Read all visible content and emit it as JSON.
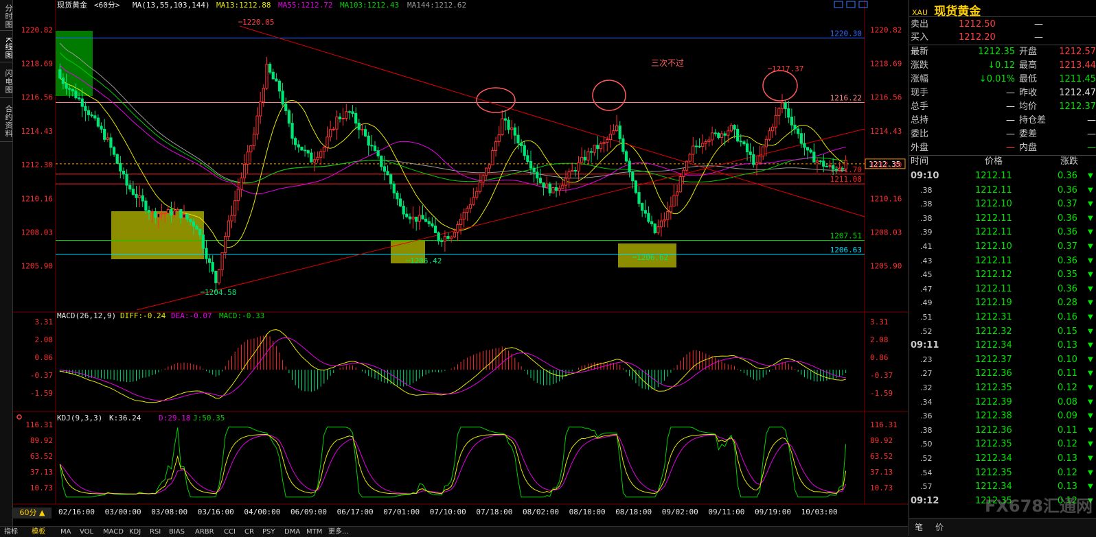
{
  "side_tabs": [
    "分时图",
    "K线图",
    "闪电图",
    "合约资料"
  ],
  "header": {
    "symbol": "现货黄金",
    "period_tag": "<60分>",
    "ma_params": "MA(13,55,103,144)",
    "ma13": "MA13:1212.88",
    "ma55": "MA55:1212.72",
    "ma103": "MA103:1212.43",
    "ma144": "MA144:1212.62"
  },
  "colors": {
    "up": "#ff3030",
    "down": "#00e676",
    "ma13": "#e8e800",
    "ma55": "#e600e6",
    "ma103": "#00d000",
    "ma144": "#9a9a9a",
    "trend": "#e00000",
    "zone": "#a6a600",
    "zone_green": "#008800",
    "support_cyan": "#00e0ff"
  },
  "price_axis": [
    "1220.82",
    "1218.69",
    "1216.56",
    "1214.43",
    "1212.30",
    "1210.16",
    "1208.03",
    "1205.90"
  ],
  "price_range": [
    1203.2,
    1221.4
  ],
  "hlines": [
    {
      "price": 1220.3,
      "label": "1220.30",
      "color": "#2f6cff"
    },
    {
      "price": 1216.22,
      "label": "1216.22",
      "color": "#ff8080"
    },
    {
      "price": 1212.35,
      "label": "",
      "color": "#ff9900",
      "dash": true
    },
    {
      "price": 1211.7,
      "label": "1211.70",
      "color": "#ff2020"
    },
    {
      "price": 1211.08,
      "label": "1211.08",
      "color": "#ff2020"
    },
    {
      "price": 1207.51,
      "label": "1207.51",
      "color": "#00d000"
    },
    {
      "price": 1206.63,
      "label": "1206.63",
      "color": "#00e0ff"
    }
  ],
  "last_price_tag": "1212.35",
  "marks": [
    {
      "label": "1220.05"
    },
    {
      "label": "1204.58"
    },
    {
      "label": "1206.42"
    },
    {
      "label": "1206.62"
    },
    {
      "label": "1217.37"
    }
  ],
  "annotation": "三次不过",
  "x_labels": [
    "02/16:00",
    "03/00:00",
    "03/08:00",
    "03/16:00",
    "04/00:00",
    "06/09:00",
    "06/17:00",
    "07/01:00",
    "07/10:00",
    "07/18:00",
    "08/02:00",
    "08/10:00",
    "08/18:00",
    "09/02:00",
    "09/11:00",
    "09/19:00",
    "10/03:00"
  ],
  "macd": {
    "title": "MACD(26,12,9)",
    "diff": "DIFF:-0.24",
    "dea": "DEA:-0.07",
    "macd": "MACD:-0.33",
    "axis": [
      "3.31",
      "2.08",
      "0.86",
      "-0.37",
      "-1.59"
    ]
  },
  "kdj": {
    "title": "KDJ(9,3,3)",
    "k": "K:36.24",
    "d": "D:29.18",
    "j": "J:50.35",
    "axis": [
      "116.31",
      "89.92",
      "63.52",
      "37.13",
      "10.73"
    ]
  },
  "period_button": "60分 ▲",
  "indicator_tabs": [
    "指标",
    "模板",
    "MA",
    "VOL",
    "MACD",
    "KDJ",
    "RSI",
    "BIAS",
    "ARBR",
    "CCI",
    "CR",
    "PSY",
    "DMA",
    "MTM",
    "更多..."
  ],
  "quote": {
    "code": "XAU",
    "name": "现货黄金",
    "sell_label": "卖出",
    "sell": "1212.50",
    "sell_vol": "—",
    "buy_label": "买入",
    "buy": "1212.20",
    "buy_vol": "—",
    "rows": [
      {
        "l1": "最新",
        "v1": "1212.35",
        "c1": "grn",
        "l2": "开盘",
        "v2": "1212.57",
        "c2": "red"
      },
      {
        "l1": "涨跌",
        "v1": "↓0.12",
        "c1": "grn",
        "l2": "最高",
        "v2": "1213.44",
        "c2": "red"
      },
      {
        "l1": "涨幅",
        "v1": "↓0.01%",
        "c1": "grn",
        "l2": "最低",
        "v2": "1211.45",
        "c2": "grn"
      },
      {
        "l1": "现手",
        "v1": "—",
        "c1": "wht",
        "l2": "昨收",
        "v2": "1212.47",
        "c2": "wht"
      },
      {
        "l1": "总手",
        "v1": "—",
        "c1": "wht",
        "l2": "均价",
        "v2": "1212.37",
        "c2": "grn"
      },
      {
        "l1": "总持",
        "v1": "—",
        "c1": "wht",
        "l2": "持仓差",
        "v2": "—",
        "c2": "wht"
      },
      {
        "l1": "委比",
        "v1": "—",
        "c1": "wht",
        "l2": "委差",
        "v2": "—",
        "c2": "wht"
      },
      {
        "l1": "外盘",
        "v1": "—",
        "c1": "red",
        "l2": "内盘",
        "v2": "—",
        "c2": "grn"
      }
    ],
    "tick_headers": [
      "时间",
      "价格",
      "涨跌"
    ],
    "ticks": [
      {
        "t": "09:10",
        "p": "1212.11",
        "c": "0.36"
      },
      {
        "t": ".38",
        "p": "1212.11",
        "c": "0.36"
      },
      {
        "t": ".38",
        "p": "1212.10",
        "c": "0.37"
      },
      {
        "t": ".38",
        "p": "1212.11",
        "c": "0.36"
      },
      {
        "t": ".39",
        "p": "1212.11",
        "c": "0.36"
      },
      {
        "t": ".41",
        "p": "1212.10",
        "c": "0.37"
      },
      {
        "t": ".43",
        "p": "1212.11",
        "c": "0.36"
      },
      {
        "t": ".45",
        "p": "1212.12",
        "c": "0.35"
      },
      {
        "t": ".47",
        "p": "1212.11",
        "c": "0.36"
      },
      {
        "t": ".49",
        "p": "1212.19",
        "c": "0.28"
      },
      {
        "t": ".51",
        "p": "1212.31",
        "c": "0.16"
      },
      {
        "t": ".52",
        "p": "1212.32",
        "c": "0.15"
      },
      {
        "t": "09:11",
        "p": "1212.34",
        "c": "0.13"
      },
      {
        "t": ".23",
        "p": "1212.37",
        "c": "0.10"
      },
      {
        "t": ".27",
        "p": "1212.36",
        "c": "0.11"
      },
      {
        "t": ".32",
        "p": "1212.35",
        "c": "0.12"
      },
      {
        "t": ".34",
        "p": "1212.39",
        "c": "0.08"
      },
      {
        "t": ".36",
        "p": "1212.38",
        "c": "0.09"
      },
      {
        "t": ".38",
        "p": "1212.36",
        "c": "0.11"
      },
      {
        "t": ".50",
        "p": "1212.35",
        "c": "0.12"
      },
      {
        "t": ".52",
        "p": "1212.34",
        "c": "0.13"
      },
      {
        "t": ".54",
        "p": "1212.35",
        "c": "0.12"
      },
      {
        "t": ".57",
        "p": "1212.34",
        "c": "0.13"
      },
      {
        "t": "09:12",
        "p": "1212.35",
        "c": "0.12"
      }
    ],
    "bottom_tabs": [
      "笔",
      "价"
    ],
    "watermark": "FX678汇通网"
  }
}
